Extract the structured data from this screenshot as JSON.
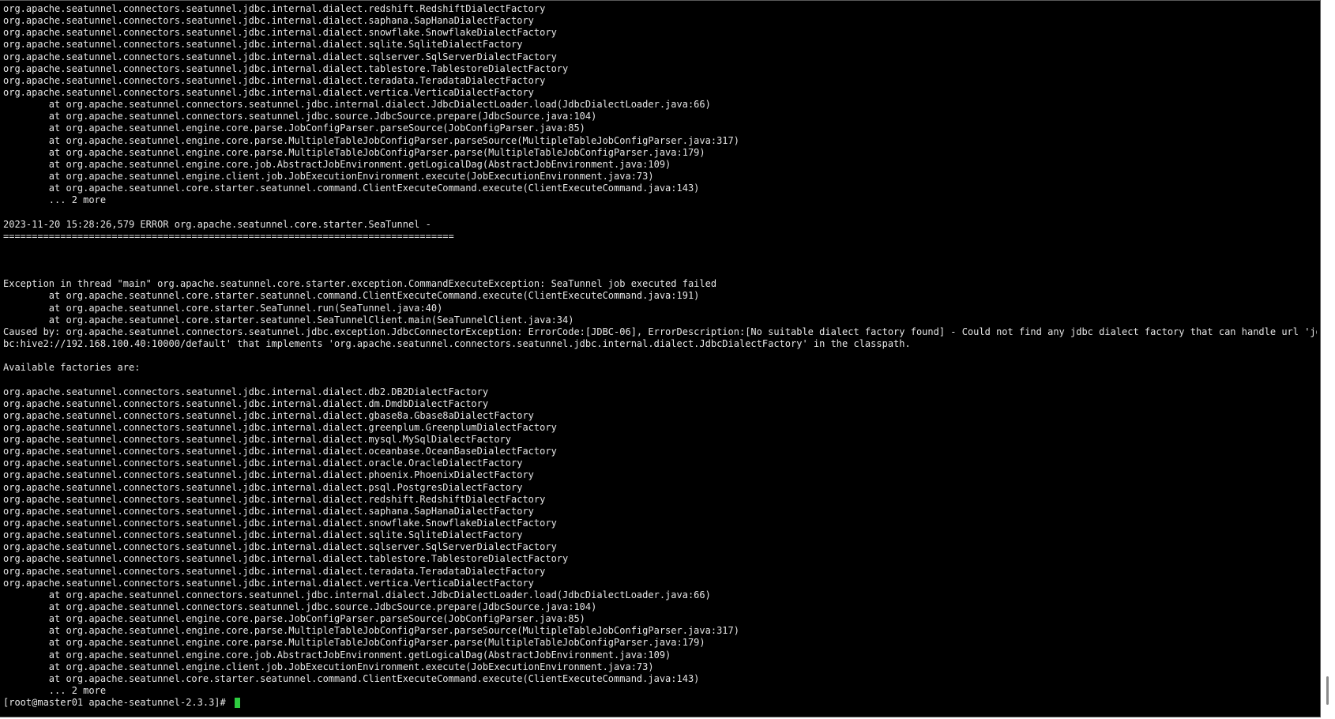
{
  "terminal": {
    "lines": [
      "org.apache.seatunnel.connectors.seatunnel.jdbc.internal.dialect.redshift.RedshiftDialectFactory",
      "org.apache.seatunnel.connectors.seatunnel.jdbc.internal.dialect.saphana.SapHanaDialectFactory",
      "org.apache.seatunnel.connectors.seatunnel.jdbc.internal.dialect.snowflake.SnowflakeDialectFactory",
      "org.apache.seatunnel.connectors.seatunnel.jdbc.internal.dialect.sqlite.SqliteDialectFactory",
      "org.apache.seatunnel.connectors.seatunnel.jdbc.internal.dialect.sqlserver.SqlServerDialectFactory",
      "org.apache.seatunnel.connectors.seatunnel.jdbc.internal.dialect.tablestore.TablestoreDialectFactory",
      "org.apache.seatunnel.connectors.seatunnel.jdbc.internal.dialect.teradata.TeradataDialectFactory",
      "org.apache.seatunnel.connectors.seatunnel.jdbc.internal.dialect.vertica.VerticaDialectFactory",
      "        at org.apache.seatunnel.connectors.seatunnel.jdbc.internal.dialect.JdbcDialectLoader.load(JdbcDialectLoader.java:66)",
      "        at org.apache.seatunnel.connectors.seatunnel.jdbc.source.JdbcSource.prepare(JdbcSource.java:104)",
      "        at org.apache.seatunnel.engine.core.parse.JobConfigParser.parseSource(JobConfigParser.java:85)",
      "        at org.apache.seatunnel.engine.core.parse.MultipleTableJobConfigParser.parseSource(MultipleTableJobConfigParser.java:317)",
      "        at org.apache.seatunnel.engine.core.parse.MultipleTableJobConfigParser.parse(MultipleTableJobConfigParser.java:179)",
      "        at org.apache.seatunnel.engine.core.job.AbstractJobEnvironment.getLogicalDag(AbstractJobEnvironment.java:109)",
      "        at org.apache.seatunnel.engine.client.job.JobExecutionEnvironment.execute(JobExecutionEnvironment.java:73)",
      "        at org.apache.seatunnel.core.starter.seatunnel.command.ClientExecuteCommand.execute(ClientExecuteCommand.java:143)",
      "        ... 2 more",
      "",
      "2023-11-20 15:28:26,579 ERROR org.apache.seatunnel.core.starter.SeaTunnel -",
      "===============================================================================",
      "",
      "",
      "",
      "Exception in thread \"main\" org.apache.seatunnel.core.starter.exception.CommandExecuteException: SeaTunnel job executed failed",
      "        at org.apache.seatunnel.core.starter.seatunnel.command.ClientExecuteCommand.execute(ClientExecuteCommand.java:191)",
      "        at org.apache.seatunnel.core.starter.SeaTunnel.run(SeaTunnel.java:40)",
      "        at org.apache.seatunnel.core.starter.seatunnel.SeaTunnelClient.main(SeaTunnelClient.java:34)",
      "Caused by: org.apache.seatunnel.connectors.seatunnel.jdbc.exception.JdbcConnectorException: ErrorCode:[JDBC-06], ErrorDescription:[No suitable dialect factory found] - Could not find any jdbc dialect factory that can handle url 'jd",
      "bc:hive2://192.168.100.40:10000/default' that implements 'org.apache.seatunnel.connectors.seatunnel.jdbc.internal.dialect.JdbcDialectFactory' in the classpath.",
      "",
      "Available factories are:",
      "",
      "org.apache.seatunnel.connectors.seatunnel.jdbc.internal.dialect.db2.DB2DialectFactory",
      "org.apache.seatunnel.connectors.seatunnel.jdbc.internal.dialect.dm.DmdbDialectFactory",
      "org.apache.seatunnel.connectors.seatunnel.jdbc.internal.dialect.gbase8a.Gbase8aDialectFactory",
      "org.apache.seatunnel.connectors.seatunnel.jdbc.internal.dialect.greenplum.GreenplumDialectFactory",
      "org.apache.seatunnel.connectors.seatunnel.jdbc.internal.dialect.mysql.MySqlDialectFactory",
      "org.apache.seatunnel.connectors.seatunnel.jdbc.internal.dialect.oceanbase.OceanBaseDialectFactory",
      "org.apache.seatunnel.connectors.seatunnel.jdbc.internal.dialect.oracle.OracleDialectFactory",
      "org.apache.seatunnel.connectors.seatunnel.jdbc.internal.dialect.phoenix.PhoenixDialectFactory",
      "org.apache.seatunnel.connectors.seatunnel.jdbc.internal.dialect.psql.PostgresDialectFactory",
      "org.apache.seatunnel.connectors.seatunnel.jdbc.internal.dialect.redshift.RedshiftDialectFactory",
      "org.apache.seatunnel.connectors.seatunnel.jdbc.internal.dialect.saphana.SapHanaDialectFactory",
      "org.apache.seatunnel.connectors.seatunnel.jdbc.internal.dialect.snowflake.SnowflakeDialectFactory",
      "org.apache.seatunnel.connectors.seatunnel.jdbc.internal.dialect.sqlite.SqliteDialectFactory",
      "org.apache.seatunnel.connectors.seatunnel.jdbc.internal.dialect.sqlserver.SqlServerDialectFactory",
      "org.apache.seatunnel.connectors.seatunnel.jdbc.internal.dialect.tablestore.TablestoreDialectFactory",
      "org.apache.seatunnel.connectors.seatunnel.jdbc.internal.dialect.teradata.TeradataDialectFactory",
      "org.apache.seatunnel.connectors.seatunnel.jdbc.internal.dialect.vertica.VerticaDialectFactory",
      "        at org.apache.seatunnel.connectors.seatunnel.jdbc.internal.dialect.JdbcDialectLoader.load(JdbcDialectLoader.java:66)",
      "        at org.apache.seatunnel.connectors.seatunnel.jdbc.source.JdbcSource.prepare(JdbcSource.java:104)",
      "        at org.apache.seatunnel.engine.core.parse.JobConfigParser.parseSource(JobConfigParser.java:85)",
      "        at org.apache.seatunnel.engine.core.parse.MultipleTableJobConfigParser.parseSource(MultipleTableJobConfigParser.java:317)",
      "        at org.apache.seatunnel.engine.core.parse.MultipleTableJobConfigParser.parse(MultipleTableJobConfigParser.java:179)",
      "        at org.apache.seatunnel.engine.core.job.AbstractJobEnvironment.getLogicalDag(AbstractJobEnvironment.java:109)",
      "        at org.apache.seatunnel.engine.client.job.JobExecutionEnvironment.execute(JobExecutionEnvironment.java:73)",
      "        at org.apache.seatunnel.core.starter.seatunnel.command.ClientExecuteCommand.execute(ClientExecuteCommand.java:143)",
      "        ... 2 more"
    ],
    "prompt": "[root@master01 apache-seatunnel-2.3.3]# ",
    "colors": {
      "background": "#000000",
      "text": "#e6e6e6",
      "cursor": "#2ecc40"
    }
  },
  "scrollbar": {
    "thumb_icon": "scrollbar-thumb"
  }
}
